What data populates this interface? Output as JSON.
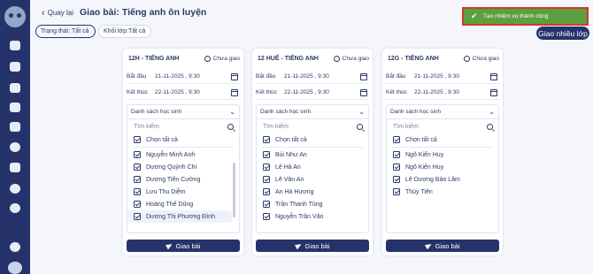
{
  "header": {
    "back_label": "Quay lại",
    "title": "Giao bài: Tiếng anh ôn luyện"
  },
  "toast": {
    "message": "Tạo nhiệm vụ thành công"
  },
  "filters": {
    "status": "Trạng thái: Tất cả",
    "grade": "Khối lớp:Tất cả"
  },
  "actions": {
    "assign_multi": "Giao nhiều lớp"
  },
  "card_labels": {
    "not_assigned": "Chưa giao",
    "start": "Bắt đầu",
    "end": "Kết thúc",
    "student_list": "Danh sách học sinh",
    "search_placeholder": "Tìm kiếm",
    "select_all": "Chọn tất cả",
    "assign": "Giao bài"
  },
  "cards": [
    {
      "name": "12H - TIẾNG ANH",
      "start": "21-11-2025 , 9:30",
      "end": "22-11-2025 , 9:30",
      "students": [
        "Nguyễn Minh Anh",
        "Dương Quỳnh Chi",
        "Dương Tiến Cường",
        "Lưu Thu Diễm",
        "Hoàng Thế Dũng",
        "Dương Thị Phương Đình"
      ]
    },
    {
      "name": "12 HUẾ - TIẾNG ANH",
      "start": "21-11-2025 , 9:30",
      "end": "22-11-2025 , 9:30",
      "students": [
        "Bùi Như An",
        "Lê Hà An",
        "Lê Vân An",
        "An Hà Hương",
        "Trần Thanh Tùng",
        "Nguyễn Trần Văn"
      ]
    },
    {
      "name": "12G - TIẾNG ANH",
      "start": "21-11-2025 , 9:30",
      "end": "22-11-2025 , 9:30",
      "students": [
        "Ngô Kiến Huy",
        "Ngô Kiến Huy",
        "Lê Dương Bảo Lâm",
        "Thùy Tiên"
      ]
    }
  ],
  "colors": {
    "primary": "#26336b",
    "toast": "#5b9f3f",
    "toast_border": "#d23a2a"
  }
}
